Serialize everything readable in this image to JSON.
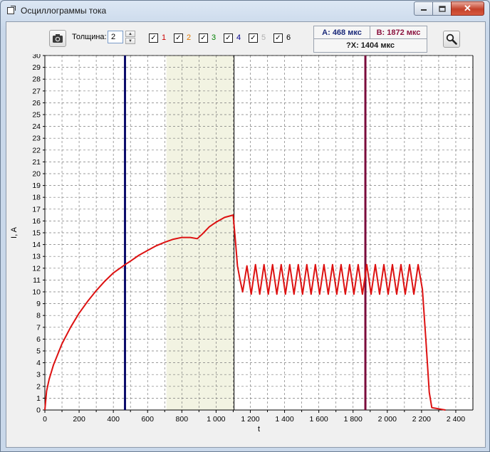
{
  "window": {
    "title": "Осциллограммы тока",
    "min_icon": "minimize-icon",
    "max_icon": "maximize-icon",
    "close_glyph": "✕"
  },
  "toolbar": {
    "camera_icon": "camera-icon",
    "thickness_label": "Толщина:",
    "thickness_value": "2",
    "channels": [
      {
        "label": "1",
        "checked": true,
        "color": "#cc0000"
      },
      {
        "label": "2",
        "checked": true,
        "color": "#e07800"
      },
      {
        "label": "3",
        "checked": true,
        "color": "#008000"
      },
      {
        "label": "4",
        "checked": true,
        "color": "#00008b"
      },
      {
        "label": "5",
        "checked": true,
        "color": "#b0b0b0"
      },
      {
        "label": "6",
        "checked": true,
        "color": "#000000"
      }
    ],
    "check_glyph": "✓",
    "zoom_icon": "zoom-icon"
  },
  "readout": {
    "a_text": "A: 468 мкс",
    "b_text": "B: 1872 мкс",
    "dx_text": "?X: 1404 мкс"
  },
  "colors": {
    "trace": "#dd1111",
    "cursor_a": "#0d0d6b",
    "cursor_b": "#7a0c3c",
    "highlight": "#f2f3e2",
    "grid": "#7a7a7a"
  },
  "chart_data": {
    "type": "line",
    "xlabel": "t",
    "ylabel": "I, A",
    "xlim": [
      0,
      2500
    ],
    "ylim": [
      0,
      30
    ],
    "x_ticks": [
      0,
      200,
      400,
      600,
      800,
      1000,
      1200,
      1400,
      1600,
      1800,
      2000,
      2200,
      2400
    ],
    "x_tick_labels": [
      "0",
      "200",
      "400",
      "600",
      "800",
      "1 000",
      "1 200",
      "1 400",
      "1 600",
      "1 800",
      "2 000",
      "2 200",
      "2 400"
    ],
    "y_ticks": [
      0,
      1,
      2,
      3,
      4,
      5,
      6,
      7,
      8,
      9,
      10,
      11,
      12,
      13,
      14,
      15,
      16,
      17,
      18,
      19,
      20,
      21,
      22,
      23,
      24,
      25,
      26,
      27,
      28,
      29,
      30
    ],
    "grid": true,
    "highlight_band": [
      710,
      1105
    ],
    "vertical_lines": [
      {
        "name": "A",
        "x": 468
      },
      {
        "name": "B",
        "x": 1872
      },
      {
        "name": "marker",
        "x": 1105
      }
    ],
    "series": [
      {
        "color": "#dd1111",
        "points": [
          [
            0,
            0
          ],
          [
            10,
            1.6
          ],
          [
            25,
            2.6
          ],
          [
            50,
            3.8
          ],
          [
            100,
            5.6
          ],
          [
            150,
            7.0
          ],
          [
            200,
            8.2
          ],
          [
            250,
            9.2
          ],
          [
            300,
            10.1
          ],
          [
            350,
            10.9
          ],
          [
            400,
            11.6
          ],
          [
            468,
            12.3
          ],
          [
            500,
            12.6
          ],
          [
            550,
            13.1
          ],
          [
            600,
            13.5
          ],
          [
            650,
            13.9
          ],
          [
            700,
            14.2
          ],
          [
            750,
            14.45
          ],
          [
            800,
            14.6
          ],
          [
            850,
            14.6
          ],
          [
            890,
            14.5
          ],
          [
            920,
            14.9
          ],
          [
            960,
            15.5
          ],
          [
            1000,
            15.9
          ],
          [
            1050,
            16.3
          ],
          [
            1100,
            16.5
          ],
          [
            1115,
            14.0
          ],
          [
            1125,
            12.2
          ],
          [
            1140,
            11.0
          ],
          [
            1155,
            10.0
          ],
          [
            1180,
            12.2
          ],
          [
            1205,
            9.8
          ],
          [
            1230,
            12.3
          ],
          [
            1255,
            9.8
          ],
          [
            1280,
            12.3
          ],
          [
            1305,
            9.8
          ],
          [
            1330,
            12.3
          ],
          [
            1355,
            9.8
          ],
          [
            1380,
            12.3
          ],
          [
            1405,
            9.8
          ],
          [
            1430,
            12.3
          ],
          [
            1455,
            9.8
          ],
          [
            1480,
            12.3
          ],
          [
            1505,
            9.8
          ],
          [
            1530,
            12.3
          ],
          [
            1555,
            9.8
          ],
          [
            1580,
            12.3
          ],
          [
            1605,
            9.8
          ],
          [
            1630,
            12.3
          ],
          [
            1655,
            9.8
          ],
          [
            1680,
            12.3
          ],
          [
            1705,
            9.8
          ],
          [
            1730,
            12.3
          ],
          [
            1755,
            9.8
          ],
          [
            1780,
            12.3
          ],
          [
            1805,
            9.8
          ],
          [
            1830,
            12.3
          ],
          [
            1855,
            9.8
          ],
          [
            1880,
            12.3
          ],
          [
            1905,
            9.8
          ],
          [
            1930,
            12.3
          ],
          [
            1955,
            9.8
          ],
          [
            1980,
            12.3
          ],
          [
            2005,
            9.8
          ],
          [
            2030,
            12.3
          ],
          [
            2055,
            9.8
          ],
          [
            2080,
            12.3
          ],
          [
            2105,
            9.8
          ],
          [
            2130,
            12.3
          ],
          [
            2155,
            9.8
          ],
          [
            2180,
            12.3
          ],
          [
            2205,
            10.2
          ],
          [
            2225,
            6.0
          ],
          [
            2245,
            1.5
          ],
          [
            2260,
            0.2
          ],
          [
            2280,
            0.15
          ],
          [
            2300,
            0.1
          ],
          [
            2320,
            0.05
          ],
          [
            2340,
            0
          ]
        ]
      }
    ]
  }
}
